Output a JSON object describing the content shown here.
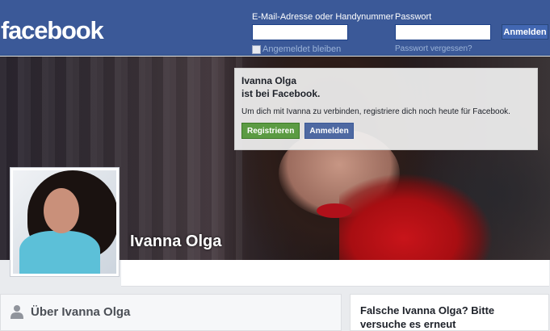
{
  "header": {
    "logo": "facebook",
    "email_label": "E-Mail-Adresse oder Handynummer",
    "password_label": "Passwort",
    "email_value": "",
    "password_value": "",
    "login_button": "Anmelden",
    "keep_logged_in": "Angemeldet bleiben",
    "forgot_password": "Passwort vergessen?"
  },
  "signup": {
    "title_line1": "Ivanna Olga",
    "title_line2": "ist bei Facebook.",
    "text": "Um dich mit Ivanna zu verbinden, registriere dich noch heute für Facebook.",
    "register_button": "Registrieren",
    "login_button": "Anmelden"
  },
  "profile": {
    "name": "Ivanna Olga"
  },
  "about": {
    "title": "Über Ivanna Olga"
  },
  "side_card": {
    "title": "Falsche Ivanna Olga? Bitte versuche es erneut"
  },
  "colors": {
    "header_blue": "#3b5998",
    "register_green": "#5b9b43",
    "login_blue": "#4e69a2"
  }
}
